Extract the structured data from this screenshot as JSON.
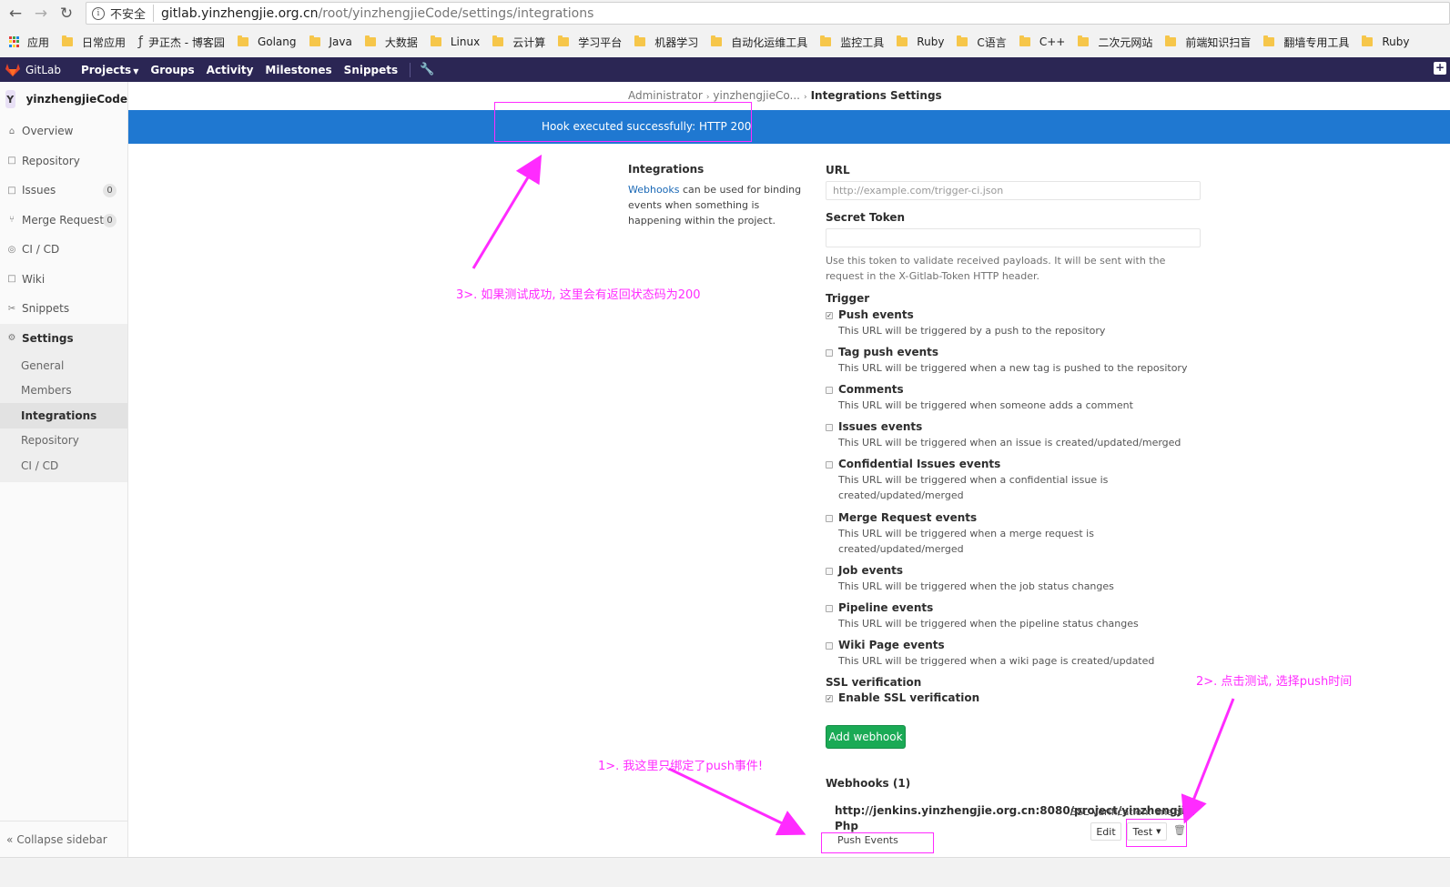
{
  "browser": {
    "insecure_label": "不安全",
    "url_host": "gitlab.yinzhengjie.org.cn",
    "url_path": "/root/yinzhengjieCode/settings/integrations",
    "bookmarks": [
      "应用",
      "日常应用",
      "尹正杰 - 博客园",
      "Golang",
      "Java",
      "大数据",
      "Linux",
      "云计算",
      "学习平台",
      "机器学习",
      "自动化运维工具",
      "监控工具",
      "Ruby",
      "C语言",
      "C++",
      "二次元网站",
      "前端知识扫盲",
      "翻墙专用工具",
      "Ruby"
    ]
  },
  "gitlab_nav": {
    "brand": "GitLab",
    "items": [
      "Projects",
      "Groups",
      "Activity",
      "Milestones",
      "Snippets"
    ]
  },
  "sidebar": {
    "project_initial": "Y",
    "project_name": "yinzhengjieCode",
    "items": [
      {
        "label": "Overview",
        "icon": "home-icon"
      },
      {
        "label": "Repository",
        "icon": "file-icon"
      },
      {
        "label": "Issues",
        "icon": "issues-icon",
        "count": "0"
      },
      {
        "label": "Merge Requests",
        "icon": "merge-icon",
        "count": "0"
      },
      {
        "label": "CI / CD",
        "icon": "rocket-icon"
      },
      {
        "label": "Wiki",
        "icon": "book-icon"
      },
      {
        "label": "Snippets",
        "icon": "scissors-icon"
      },
      {
        "label": "Settings",
        "icon": "gear-icon"
      }
    ],
    "sub_items": [
      "General",
      "Members",
      "Integrations",
      "Repository",
      "CI / CD"
    ],
    "collapse": "Collapse sidebar"
  },
  "breadcrumb": {
    "a": "Administrator",
    "b": "yinzhengjieCo...",
    "current": "Integrations Settings"
  },
  "flash": "Hook executed successfully: HTTP 200",
  "intro": {
    "title": "Integrations",
    "link": "Webhooks",
    "text": " can be used for binding events when something is happening within the project."
  },
  "form": {
    "url_label": "URL",
    "url_placeholder": "http://example.com/trigger-ci.json",
    "token_label": "Secret Token",
    "token_help": "Use this token to validate received payloads. It will be sent with the request in the X-Gitlab-Token HTTP header.",
    "trigger_label": "Trigger",
    "triggers": [
      {
        "title": "Push events",
        "desc": "This URL will be triggered by a push to the repository",
        "checked": true
      },
      {
        "title": "Tag push events",
        "desc": "This URL will be triggered when a new tag is pushed to the repository",
        "checked": false
      },
      {
        "title": "Comments",
        "desc": "This URL will be triggered when someone adds a comment",
        "checked": false
      },
      {
        "title": "Issues events",
        "desc": "This URL will be triggered when an issue is created/updated/merged",
        "checked": false
      },
      {
        "title": "Confidential Issues events",
        "desc": "This URL will be triggered when a confidential issue is created/updated/merged",
        "checked": false
      },
      {
        "title": "Merge Request events",
        "desc": "This URL will be triggered when a merge request is created/updated/merged",
        "checked": false
      },
      {
        "title": "Job events",
        "desc": "This URL will be triggered when the job status changes",
        "checked": false
      },
      {
        "title": "Pipeline events",
        "desc": "This URL will be triggered when the pipeline status changes",
        "checked": false
      },
      {
        "title": "Wiki Page events",
        "desc": "This URL will be triggered when a wiki page is created/updated",
        "checked": false
      }
    ],
    "ssl_label": "SSL verification",
    "ssl_option": "Enable SSL verification",
    "add_button": "Add webhook"
  },
  "webhooks": {
    "title": "Webhooks (1)",
    "url": "http://jenkins.yinzhengjie.org.cn:8080/project/yinzhengjie-Php",
    "ssl": "SSL Verification: enabled",
    "events": "Push Events",
    "edit": "Edit",
    "test": "Test"
  },
  "annotations": {
    "note1": "1>. 我这里只绑定了push事件!",
    "note2": "2>. 点击测试, 选择push时间",
    "note3": "3>. 如果测试成功, 这里会有返回状态码为200",
    "color": "#ff2bff"
  }
}
